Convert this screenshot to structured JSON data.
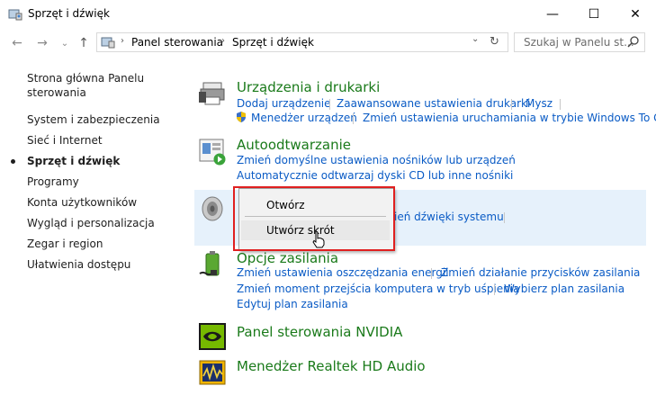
{
  "window": {
    "title": "Sprzęt i dźwięk",
    "minimize_glyph": "—",
    "maximize_glyph": "☐",
    "close_glyph": "✕"
  },
  "nav": {
    "back_glyph": "←",
    "forward_glyph": "→",
    "dropdown_glyph": "⌄",
    "up_glyph": "↑",
    "breadcrumbs": [
      "Panel sterowania",
      "Sprzęt i dźwięk"
    ],
    "crumb_sep": "›",
    "address_dropdown_glyph": "⌄",
    "refresh_glyph": "↻",
    "search_placeholder": "Szukaj w Panelu st..."
  },
  "sidebar": {
    "home_line1": "Strona główna Panelu",
    "home_line2": "sterowania",
    "items": [
      {
        "label": "System i zabezpieczenia"
      },
      {
        "label": "Sieć i Internet"
      },
      {
        "label": "Sprzęt i dźwięk",
        "active": true
      },
      {
        "label": "Programy"
      },
      {
        "label": "Konta użytkowników"
      },
      {
        "label": "Wygląd i personalizacja"
      },
      {
        "label": "Zegar i region"
      },
      {
        "label": "Ułatwienia dostępu"
      }
    ]
  },
  "categories": {
    "devices": {
      "title": "Urządzenia i drukarki",
      "links": [
        "Dodaj urządzenie",
        "Zaawansowane ustawienia drukarki",
        "Mysz",
        "Menedżer urządzeń",
        "Zmień ustawienia uruchamiania w trybie Windows To Go"
      ]
    },
    "autoplay": {
      "title": "Autoodtwarzanie",
      "links": [
        "Zmień domyślne ustawienia nośników lub urządzeń",
        "Automatycznie odtwarzaj dyski CD lub inne nośniki"
      ]
    },
    "sound": {
      "partial_link": "ień dźwięki systemu"
    },
    "power": {
      "title": "Opcje zasilania",
      "links": [
        "Zmień ustawienia oszczędzania energii",
        "Zmień działanie przycisków zasilania",
        "Zmień moment przejścia komputera w tryb uśpienia",
        "Wybierz plan zasilania",
        "Edytuj plan zasilania"
      ]
    },
    "nvidia": {
      "title": "Panel sterowania NVIDIA"
    },
    "realtek": {
      "title": "Menedżer Realtek HD Audio"
    }
  },
  "context_menu": {
    "items": [
      "Otwórz",
      "Utwórz skrót"
    ]
  },
  "colors": {
    "category_title": "#1a7a1a",
    "link": "#0a5bc5",
    "highlight": "#e6f1fb",
    "annotation": "#e02020"
  }
}
